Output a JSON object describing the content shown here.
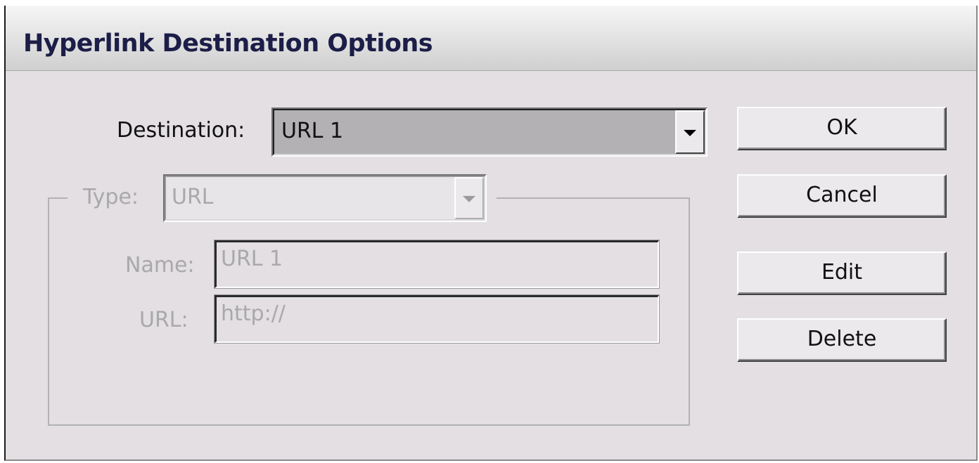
{
  "window": {
    "title": "Hyperlink Destination Options"
  },
  "destination": {
    "label": "Destination:",
    "selected": "URL 1",
    "dropdown_icon": "chevron-down-icon"
  },
  "type": {
    "label": "Type:",
    "selected": "URL",
    "enabled": false
  },
  "name_field": {
    "label": "Name:",
    "value": "URL 1",
    "enabled": false
  },
  "url_field": {
    "label": "URL:",
    "value": "http://",
    "enabled": false
  },
  "buttons": {
    "ok": "OK",
    "cancel": "Cancel",
    "edit": "Edit",
    "delete": "Delete"
  },
  "colors": {
    "dialog_bg": "#e3dfe3",
    "title_text": "#1c1e48",
    "selected_dropdown_bg": "#b3b1b3",
    "disabled_text": "#a9a9a9"
  }
}
